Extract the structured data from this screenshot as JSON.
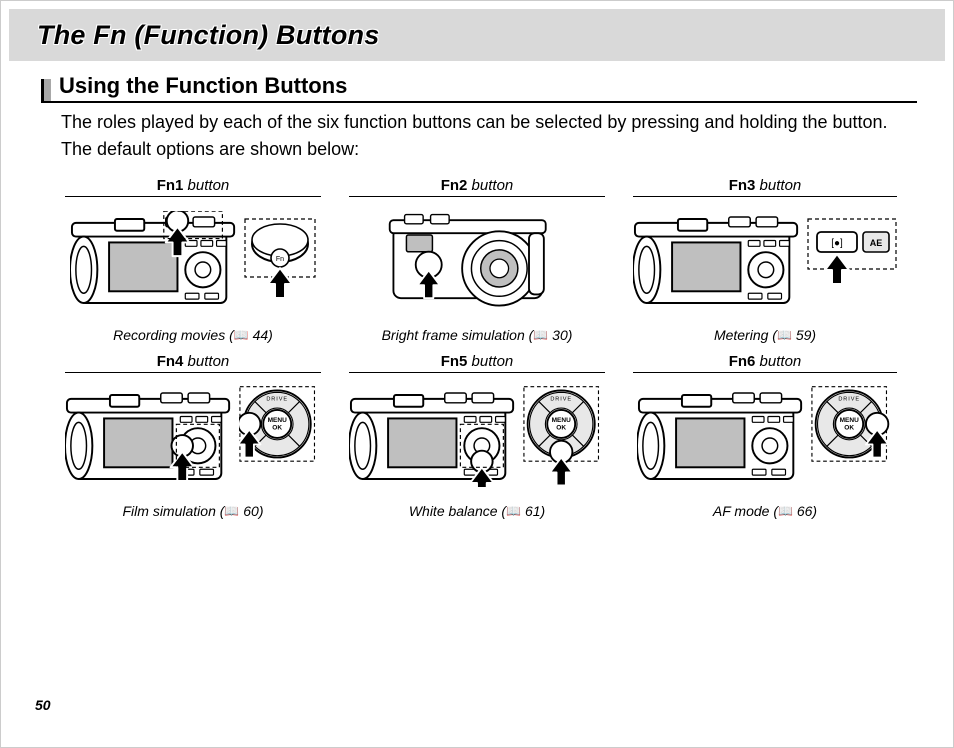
{
  "page": {
    "title": "The Fn (Function) Buttons",
    "section_title": "Using the Function Buttons",
    "intro": "The roles played by each of the six function buttons can be selected by pressing and holding the button.  The default options are shown below:",
    "page_number": "50"
  },
  "items": [
    {
      "fn": "Fn1",
      "label_suffix": " button",
      "caption_pre": "Recording movies (",
      "caption_page": "44",
      "caption_post": ")",
      "callout": "top"
    },
    {
      "fn": "Fn2",
      "label_suffix": " button",
      "caption_pre": "Bright frame simulation (",
      "caption_page": "30",
      "caption_post": ")",
      "callout": "front"
    },
    {
      "fn": "Fn3",
      "label_suffix": " button",
      "caption_pre": "Metering (",
      "caption_page": "59",
      "caption_post": ")",
      "callout": "ael"
    },
    {
      "fn": "Fn4",
      "label_suffix": " button",
      "caption_pre": "Film simulation (",
      "caption_page": "60",
      "caption_post": ")",
      "callout": "dpad-left"
    },
    {
      "fn": "Fn5",
      "label_suffix": " button",
      "caption_pre": "White balance (",
      "caption_page": "61",
      "caption_post": ")",
      "callout": "dpad-down"
    },
    {
      "fn": "Fn6",
      "label_suffix": " button",
      "caption_pre": "AF mode (",
      "caption_page": "66",
      "caption_post": ")",
      "callout": "dpad-right"
    }
  ]
}
